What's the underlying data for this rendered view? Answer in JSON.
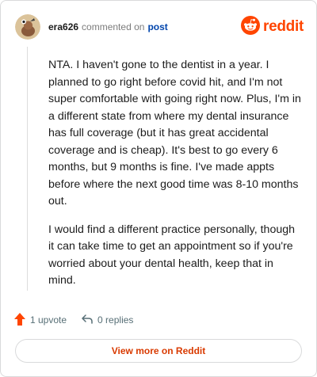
{
  "header": {
    "author": "era626",
    "action_text": "commented on",
    "post_link": "post",
    "brand": "reddit"
  },
  "comment": {
    "paragraphs": [
      "NTA. I haven't gone to the dentist in a year. I planned to go right before covid hit, and I'm not super comfortable with going right now. Plus, I'm in a different state from where my dental insurance has full coverage (but it has great accidental coverage and is cheap). It's best to go every 6 months, but 9 months is fine. I've made appts before where the next good time was 8-10 months out.",
      "I would find a different practice personally, though it can take time to get an appointment so if you're worried about your dental health, keep that in mind."
    ]
  },
  "actions": {
    "upvotes": "1 upvote",
    "replies": "0 replies"
  },
  "footer": {
    "view_more": "View more on Reddit"
  },
  "colors": {
    "brand": "#ff4500",
    "upvote_icon": "#ff4500",
    "link": "#0045ac",
    "view_more_text": "#d93a00",
    "avatar_bg": "#dbc39a"
  },
  "icons": [
    "avatar",
    "reddit-snoo-icon",
    "upvote-arrow-icon",
    "reply-icon"
  ]
}
